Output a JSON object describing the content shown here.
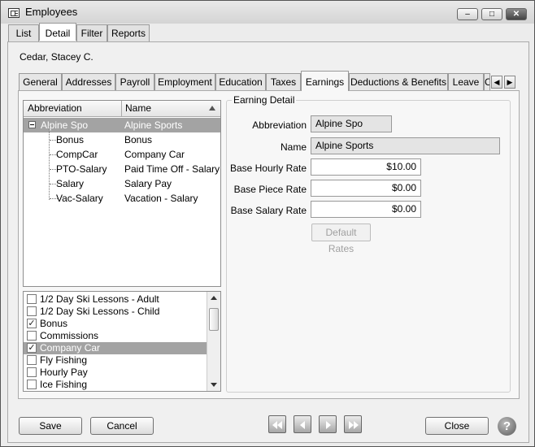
{
  "window": {
    "title": "Employees",
    "minimize_glyph": "–",
    "maximize_glyph": "□",
    "close_glyph": "✕"
  },
  "top_tabs": [
    "List",
    "Detail",
    "Filter",
    "Reports"
  ],
  "employee_name": "Cedar, Stacey C.",
  "detail_tabs": [
    "General",
    "Addresses",
    "Payroll",
    "Employment",
    "Education",
    "Taxes",
    "Earnings",
    "Deductions & Benefits",
    "Leave",
    "C"
  ],
  "active_detail_tab": "Earnings",
  "tree": {
    "columns": [
      "Abbreviation",
      "Name"
    ],
    "rows": [
      {
        "abbr": "Alpine Spo",
        "name": "Alpine Sports"
      },
      {
        "abbr": "Bonus",
        "name": "Bonus"
      },
      {
        "abbr": "CompCar",
        "name": "Company Car"
      },
      {
        "abbr": "PTO-Salary",
        "name": "Paid Time Off - Salary"
      },
      {
        "abbr": "Salary",
        "name": "Salary Pay"
      },
      {
        "abbr": "Vac-Salary",
        "name": "Vacation - Salary"
      }
    ]
  },
  "checklist": [
    {
      "label": "1/2 Day Ski Lessons - Adult",
      "checked": false,
      "mark": ""
    },
    {
      "label": "1/2 Day Ski Lessons - Child",
      "checked": false,
      "mark": ""
    },
    {
      "label": "Bonus",
      "checked": true,
      "mark": "✓"
    },
    {
      "label": "Commissions",
      "checked": false,
      "mark": ""
    },
    {
      "label": "Company Car",
      "checked": true,
      "mark": "✓"
    },
    {
      "label": "Fly Fishing",
      "checked": false,
      "mark": ""
    },
    {
      "label": "Hourly Pay",
      "checked": false,
      "mark": ""
    },
    {
      "label": "Ice Fishing",
      "checked": false,
      "mark": ""
    }
  ],
  "earning_detail": {
    "title": "Earning Detail",
    "abbreviation_label": "Abbreviation",
    "abbreviation_value": "Alpine Spo",
    "name_label": "Name",
    "name_value": "Alpine Sports",
    "hourly_label": "Base Hourly Rate",
    "hourly_value": "$10.00",
    "piece_label": "Base Piece Rate",
    "piece_value": "$0.00",
    "salary_label": "Base Salary Rate",
    "salary_value": "$0.00",
    "default_rates_label": "Default Rates"
  },
  "footer": {
    "save_label": "Save",
    "cancel_label": "Cancel",
    "close_label": "Close",
    "help_glyph": "?"
  }
}
